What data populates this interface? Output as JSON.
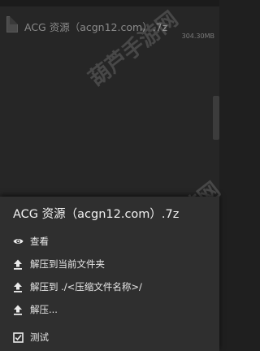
{
  "background": {
    "file_name": "ACG 资源（acgn12.com）.7z",
    "file_size": "304.30MB"
  },
  "sheet": {
    "title": "ACG 资源（acgn12.com）.7z",
    "items": [
      {
        "label": "查看",
        "icon": "eye-icon"
      },
      {
        "label": "解压到当前文件夹",
        "icon": "upload-arrow-icon"
      },
      {
        "label": "解压到 ./<压缩文件名称>/",
        "icon": "upload-arrow-icon"
      },
      {
        "label": "解压...",
        "icon": "upload-arrow-icon"
      },
      {
        "label": "测试",
        "icon": "checkbox-icon"
      }
    ]
  },
  "watermark": "葫芦手游网",
  "colors": {
    "sheet_background": "#2f2f2f",
    "screen_background": "#262626",
    "text": "#e8e8e8"
  }
}
